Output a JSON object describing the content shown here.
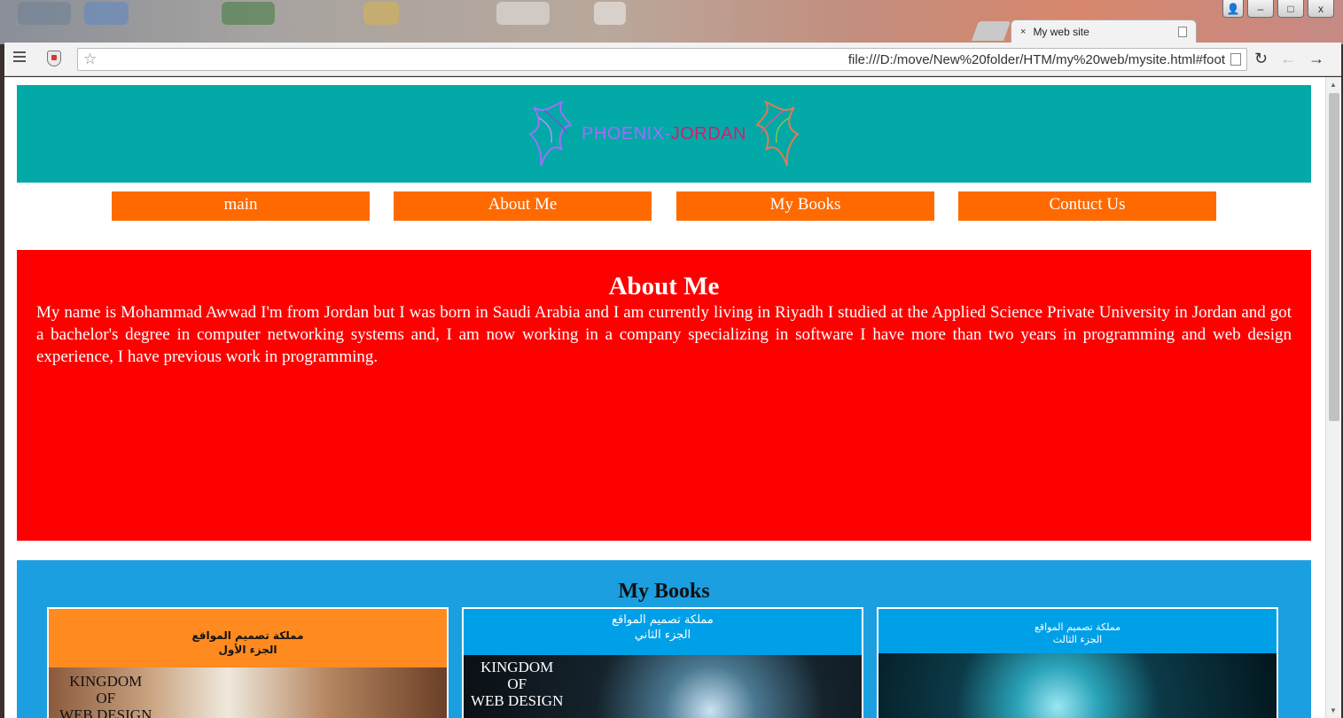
{
  "browser": {
    "tab_title": "My web site",
    "tab_close": "×",
    "url": "file:///D:/move/New%20folder/HTM/my%20web/mysite.html#foot",
    "star": "☆",
    "reload": "↻",
    "back": "←",
    "forward": "→"
  },
  "window_controls": {
    "user": "👤",
    "minimize": "–",
    "maximize": "□",
    "close": "x"
  },
  "site": {
    "logo_part1": "PHOENIX-",
    "logo_part2": "JORDAN",
    "nav": [
      {
        "label": "main"
      },
      {
        "label": "About Me"
      },
      {
        "label": "My Books"
      },
      {
        "label": "Contuct Us"
      }
    ],
    "about": {
      "title": "About Me",
      "text": "My name is Mohammad Awwad I'm from Jordan but I was born in Saudi Arabia and I am currently living in Riyadh I studied at the Applied Science Private University in Jordan and got a bachelor's degree in computer networking systems and, I am now working in a company specializing in software I have more than two years in programming and web design experience, I have previous work in programming."
    },
    "books": {
      "title": "My Books",
      "items": [
        {
          "head_line1": "مملكة تصميم المواقع",
          "head_line2": "الجزء الأول",
          "cover_line1": "KINGDOM",
          "cover_line2": "OF",
          "cover_line3": "WEB DESIGN"
        },
        {
          "head_line1": "مملكة تصميم المواقع",
          "head_line2": "الجزء الثاني",
          "cover_line1": "KINGDOM",
          "cover_line2": "OF",
          "cover_line3": "WEB DESIGN"
        },
        {
          "head_line1": "مملكة تصميم المواقع",
          "head_line2": "الجزء الثالث"
        }
      ]
    }
  },
  "colors": {
    "header": "#02a9a6",
    "nav": "#ff6a00",
    "about_bg": "#ff0000",
    "books_bg": "#1b9fe0"
  }
}
